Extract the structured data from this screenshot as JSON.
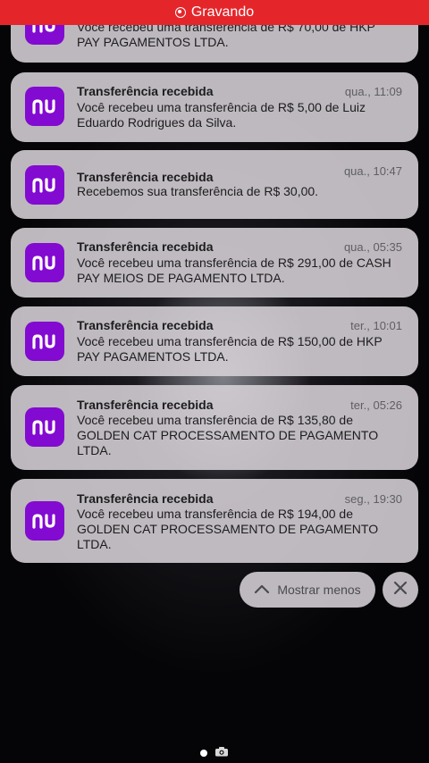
{
  "recording_bar": {
    "label": "Gravando"
  },
  "notifications": [
    {
      "title": "",
      "time": "",
      "body": "Você recebeu uma transferência de R$ 70,00 de HKP PAY PAGAMENTOS LTDA."
    },
    {
      "title": "Transferência recebida",
      "time": "qua., 11:09",
      "body": "Você recebeu uma transferência de R$ 5,00 de Luiz Eduardo Rodrigues da Silva."
    },
    {
      "title": "Transferência recebida",
      "time": "qua., 10:47",
      "body": "Recebemos sua transferência de R$ 30,00."
    },
    {
      "title": "Transferência recebida",
      "time": "qua., 05:35",
      "body": "Você recebeu uma transferência de R$ 291,00 de CASH PAY MEIOS DE PAGAMENTO LTDA."
    },
    {
      "title": "Transferência recebida",
      "time": "ter., 10:01",
      "body": "Você recebeu uma transferência de R$ 150,00 de HKP PAY PAGAMENTOS LTDA."
    },
    {
      "title": "Transferência recebida",
      "time": "ter., 05:26",
      "body": "Você recebeu uma transferência de R$ 135,80 de GOLDEN CAT PROCESSAMENTO DE PAGAMENTO LTDA."
    },
    {
      "title": "Transferência recebida",
      "time": "seg., 19:30",
      "body": "Você recebeu uma transferência de R$ 194,00 de GOLDEN CAT PROCESSAMENTO DE PAGAMENTO LTDA."
    }
  ],
  "controls": {
    "show_less_label": "Mostrar menos"
  },
  "colors": {
    "recording_red": "#e4262b",
    "nubank_purple": "#820ad1"
  },
  "icons": {
    "app": "nubank-logo-icon",
    "show_less": "chevron-up-icon",
    "close": "close-icon",
    "camera": "camera-icon"
  }
}
